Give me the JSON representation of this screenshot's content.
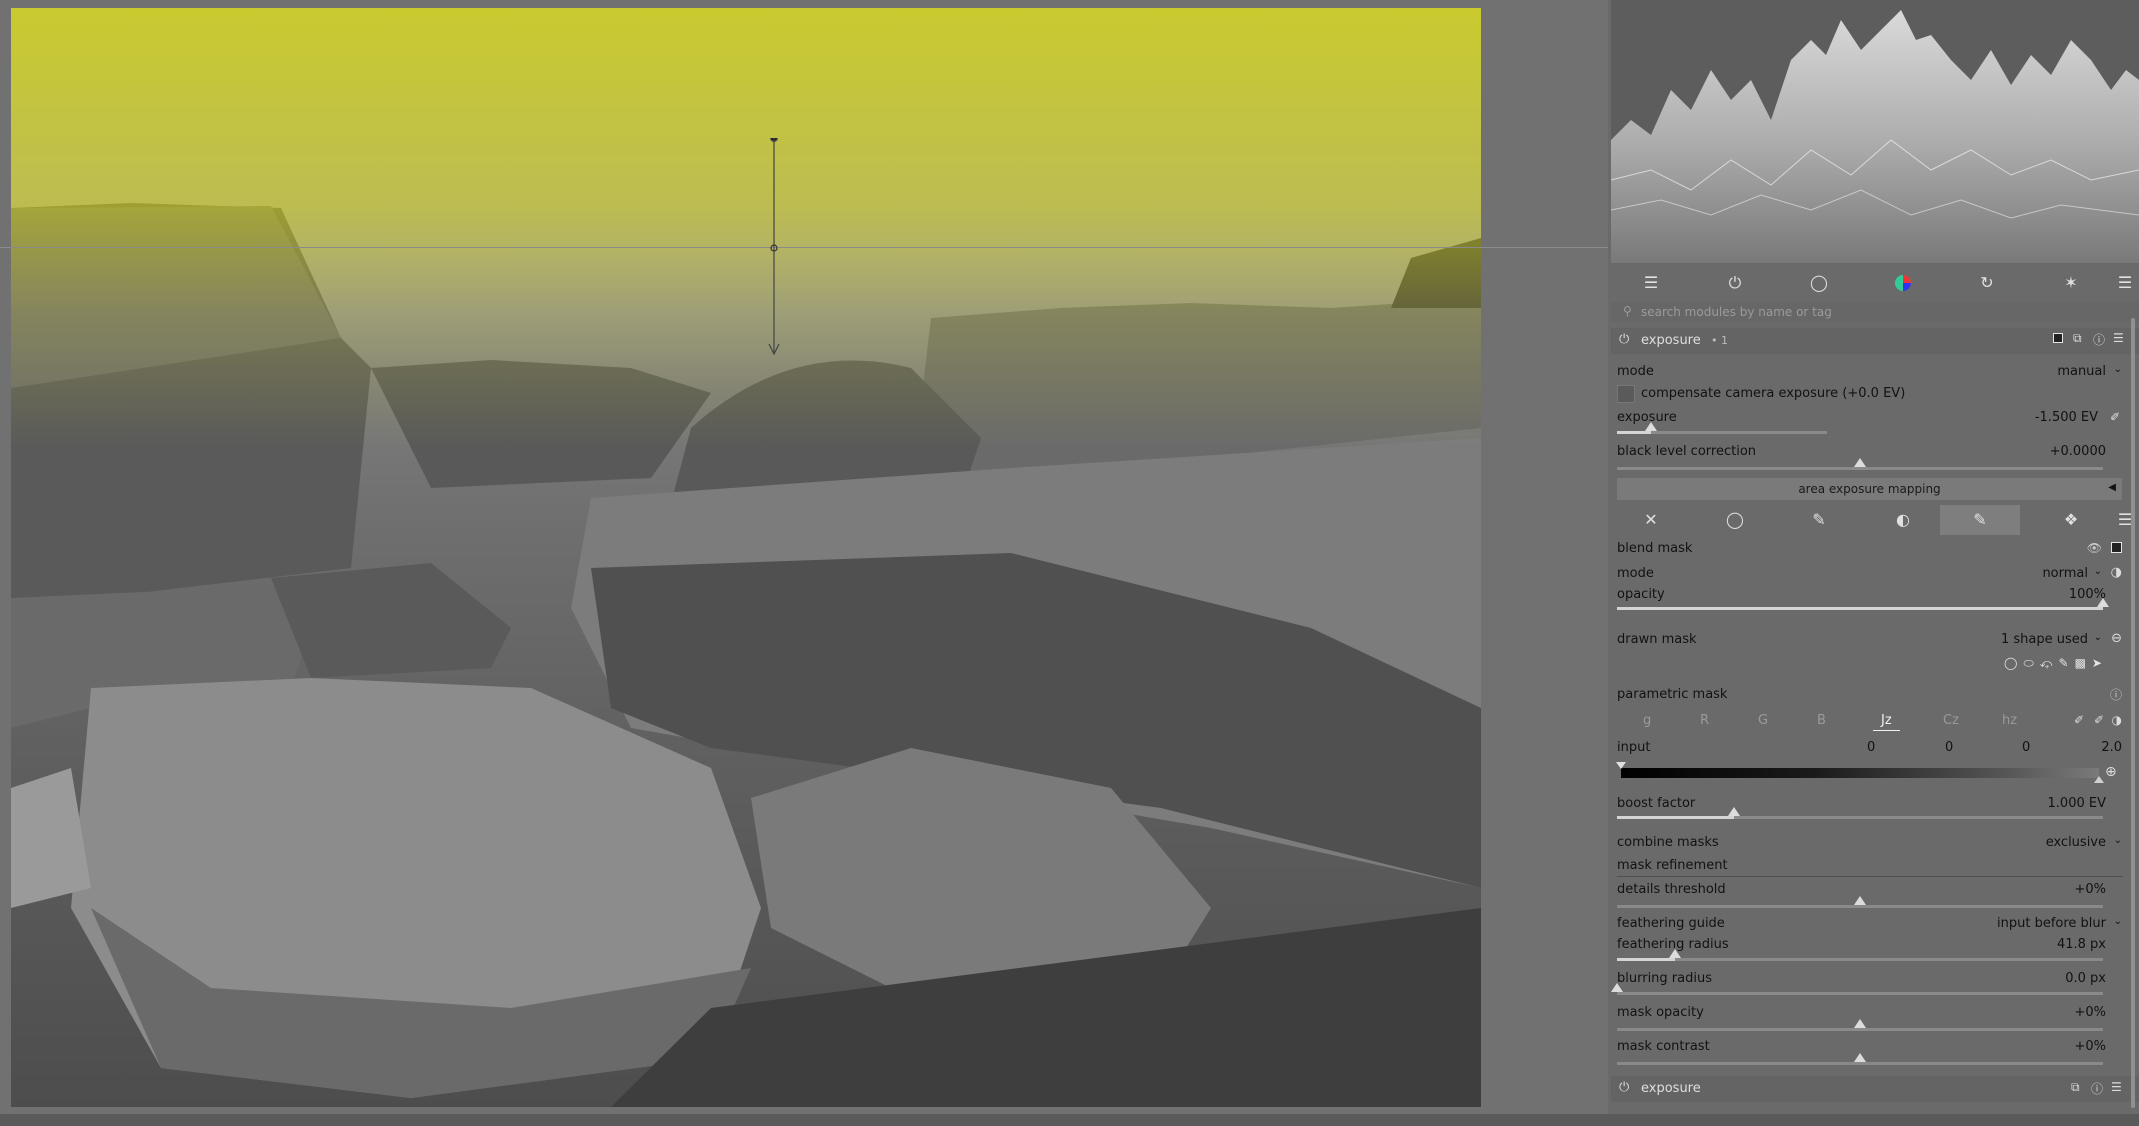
{
  "search": {
    "placeholder": "search modules by name or tag"
  },
  "module_header": {
    "name": "exposure",
    "instance": "• 1"
  },
  "exposure": {
    "mode_label": "mode",
    "mode_value": "manual",
    "compensate_label": "compensate camera exposure (+0.0 EV)",
    "exposure_label": "exposure",
    "exposure_value": "-1.500 EV",
    "black_label": "black level correction",
    "black_value": "+0.0000",
    "area_label": "area exposure mapping"
  },
  "blend": {
    "section": "blend mask",
    "mode_label": "mode",
    "mode_value": "normal",
    "opacity_label": "opacity",
    "opacity_value": "100%",
    "drawn_label": "drawn mask",
    "drawn_value": "1 shape used",
    "parametric_label": "parametric mask",
    "channels": [
      "g",
      "R",
      "G",
      "B",
      "Jz",
      "Cz",
      "hz"
    ],
    "input_label": "input",
    "input_values": [
      "0",
      "0",
      "0",
      "2.0"
    ],
    "boost_label": "boost factor",
    "boost_value": "1.000 EV",
    "combine_label": "combine masks",
    "combine_value": "exclusive",
    "refinement_label": "mask refinement",
    "details_label": "details threshold",
    "details_value": "+0%",
    "guide_label": "feathering guide",
    "guide_value": "input before blur",
    "radius_label": "feathering radius",
    "radius_value": "41.8 px",
    "blur_label": "blurring radius",
    "blur_value": "0.0 px",
    "mask_opacity_label": "mask opacity",
    "mask_opacity_value": "+0%",
    "contrast_label": "mask contrast",
    "contrast_value": "+0%"
  },
  "next_module": {
    "name": "exposure"
  },
  "levels": {
    "exposure": 0.16,
    "black": 0.5,
    "opacity": 1.0,
    "boost": 0.24,
    "details": 0.5,
    "radius": 0.12,
    "blur": 0.0,
    "mask_opacity": 0.5,
    "contrast": 0.5
  },
  "colors": {
    "overlay": "#d6d600",
    "panel": "#6a6a6a",
    "text": "#121212"
  }
}
